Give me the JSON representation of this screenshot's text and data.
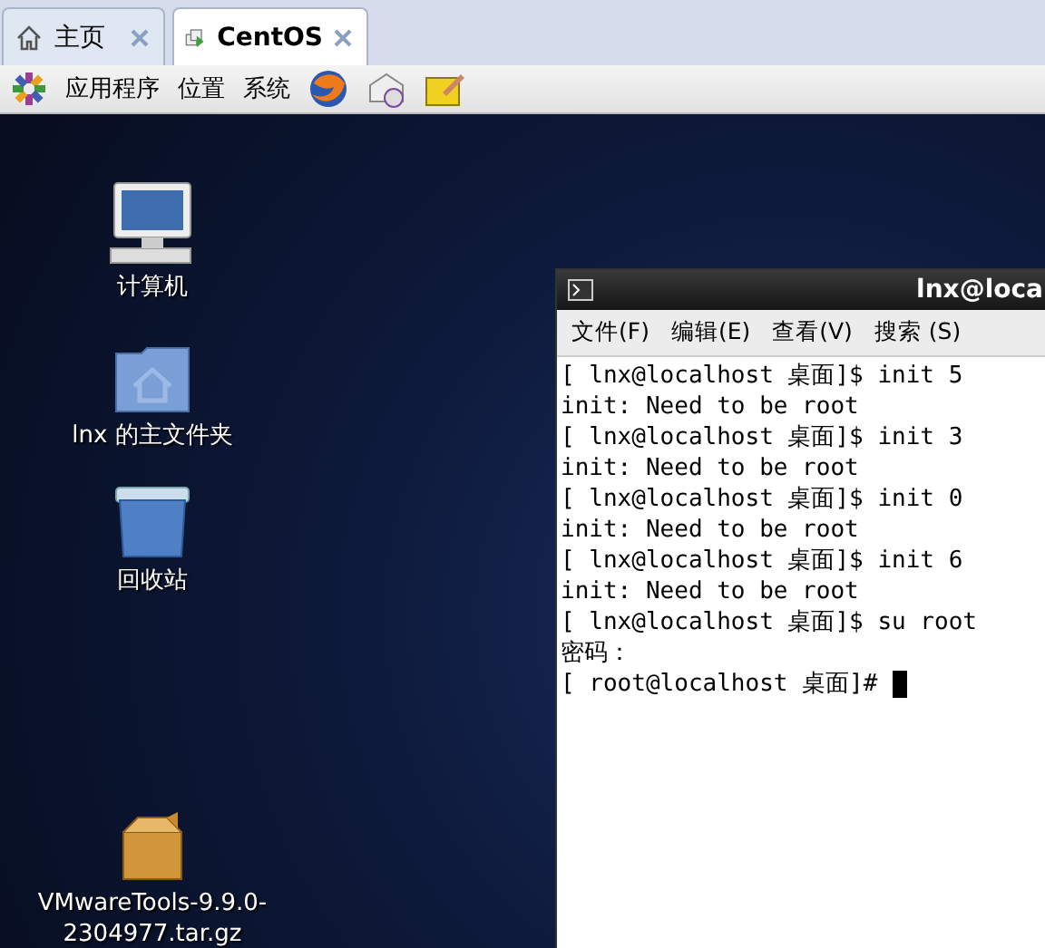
{
  "tabs": [
    {
      "label": "主页",
      "kind": "home",
      "selected": false
    },
    {
      "label": "CentOS",
      "kind": "vm",
      "selected": true
    }
  ],
  "panel_menu": [
    "应用程序",
    "位置",
    "系统"
  ],
  "desktop_icons": [
    {
      "label": "计算机",
      "kind": "computer"
    },
    {
      "label": "lnx 的主文件夹",
      "kind": "home-folder"
    },
    {
      "label": "回收站",
      "kind": "trash"
    },
    {
      "label": "VMwareTools-9.9.0-2304977.tar.gz",
      "kind": "package"
    }
  ],
  "terminal": {
    "title": "lnx@loca",
    "menu": [
      "文件(F)",
      "编辑(E)",
      "查看(V)",
      "搜索 (S)"
    ],
    "lines": [
      "[ lnx@localhost 桌面]$ init 5",
      "init: Need to be root",
      "[ lnx@localhost 桌面]$ init 3",
      "init: Need to be root",
      "[ lnx@localhost 桌面]$ init 0",
      "init: Need to be root",
      "[ lnx@localhost 桌面]$ init 6",
      "init: Need to be root",
      "[ lnx@localhost 桌面]$ su root",
      "密码：",
      "[ root@localhost 桌面]# "
    ]
  }
}
